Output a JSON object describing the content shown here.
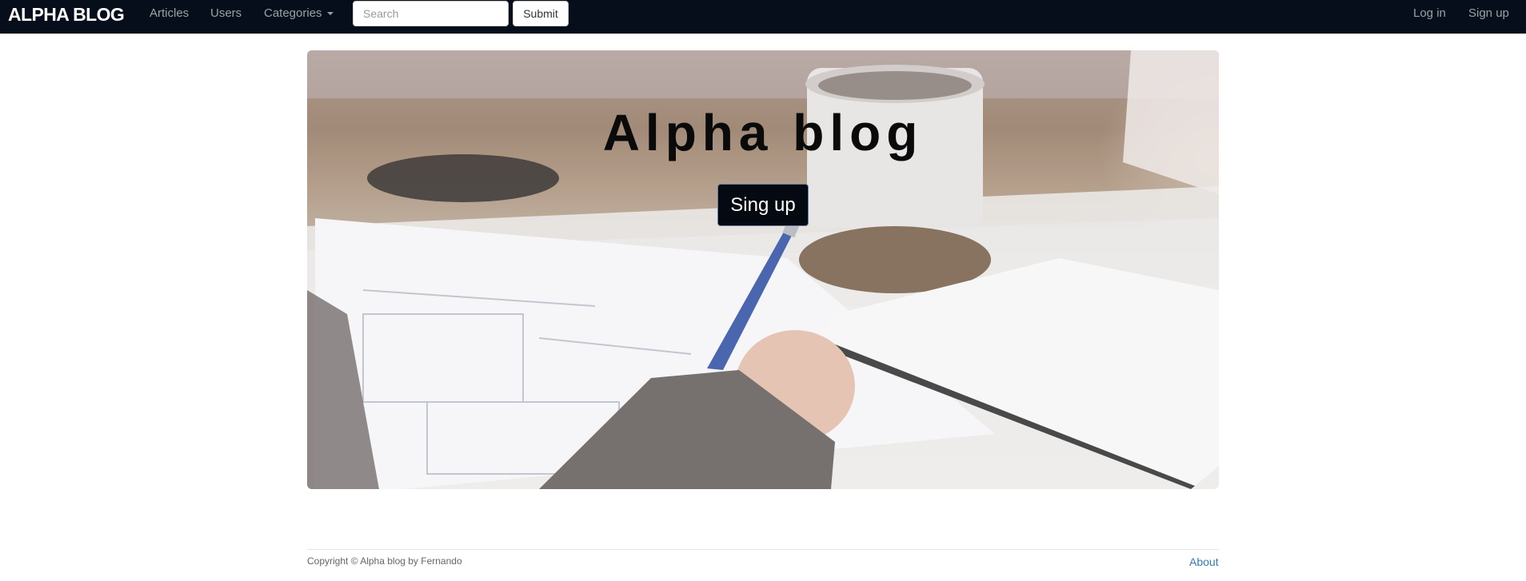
{
  "navbar": {
    "brand": "ALPHA BLOG",
    "links": {
      "articles": "Articles",
      "users": "Users",
      "categories": "Categories"
    },
    "search": {
      "placeholder": "Search",
      "value": ""
    },
    "submit_label": "Submit",
    "right_links": {
      "login": "Log in",
      "signup": "Sign up"
    }
  },
  "hero": {
    "title": "Alpha blog",
    "button_label": "Sing up",
    "background_image": "desk-writing-photo"
  },
  "footer": {
    "copyright": "Copyright © Alpha blog by Fernando",
    "about": "About"
  },
  "colors": {
    "navbar_bg": "#050e1a",
    "link": "#337ab7",
    "hero_button_bg": "#050a12"
  }
}
